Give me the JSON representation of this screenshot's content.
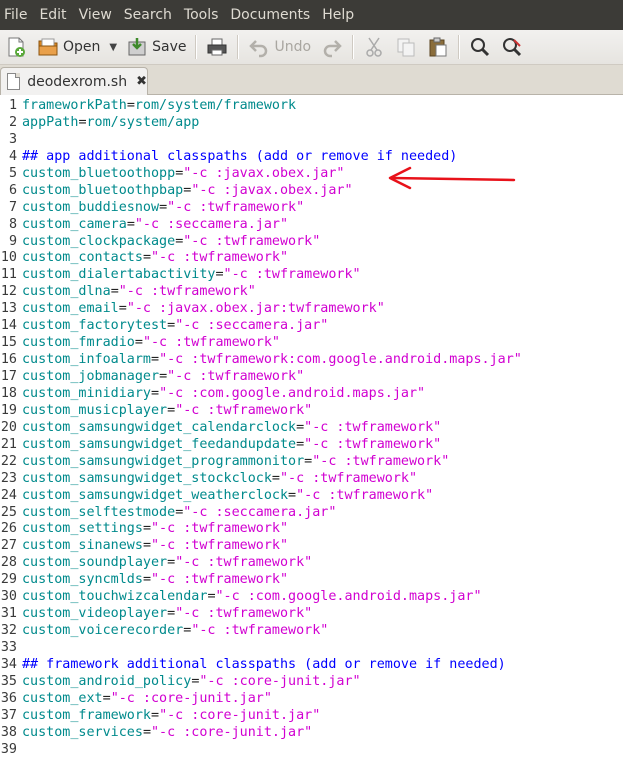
{
  "menubar": {
    "items": [
      "File",
      "Edit",
      "View",
      "Search",
      "Tools",
      "Documents",
      "Help"
    ]
  },
  "toolbar": {
    "new_icon": "new-document-icon",
    "open_label": "Open",
    "open_icon": "open-folder-icon",
    "save_label": "Save",
    "save_icon": "save-icon",
    "print_icon": "print-icon",
    "undo_label": "Undo",
    "undo_icon": "undo-icon",
    "redo_icon": "redo-icon",
    "cut_icon": "cut-icon",
    "copy_icon": "copy-icon",
    "paste_icon": "paste-icon",
    "find_icon": "find-icon",
    "replace_icon": "find-replace-icon"
  },
  "tab": {
    "filename": "deodexrom.sh",
    "close_glyph": "✖"
  },
  "colors": {
    "variable": "#008a8c",
    "string": "#d100d1",
    "comment": "#0000ff",
    "annotation_arrow": "#e8121a"
  },
  "code": {
    "lines": [
      {
        "n": "1",
        "var": "frameworkPath",
        "op": "=",
        "str": "",
        "plain": "rom/system/framework"
      },
      {
        "n": "2",
        "var": "appPath",
        "op": "=",
        "str": "",
        "plain": "rom/system/app"
      },
      {
        "n": "3",
        "var": "",
        "op": "",
        "str": "",
        "plain": ""
      },
      {
        "n": "4",
        "comment": "## app additional classpaths (add or remove if needed)"
      },
      {
        "n": "5",
        "var": "custom_bluetoothopp",
        "op": "=",
        "str": "\"-c :javax.obex.jar\""
      },
      {
        "n": "6",
        "var": "custom_bluetoothpbap",
        "op": "=",
        "str": "\"-c :javax.obex.jar\""
      },
      {
        "n": "7",
        "var": "custom_buddiesnow",
        "op": "=",
        "str": "\"-c :twframework\""
      },
      {
        "n": "8",
        "var": "custom_camera",
        "op": "=",
        "str": "\"-c :seccamera.jar\""
      },
      {
        "n": "9",
        "var": "custom_clockpackage",
        "op": "=",
        "str": "\"-c :twframework\""
      },
      {
        "n": "10",
        "var": "custom_contacts",
        "op": "=",
        "str": "\"-c :twframework\""
      },
      {
        "n": "11",
        "var": "custom_dialertabactivity",
        "op": "=",
        "str": "\"-c :twframework\""
      },
      {
        "n": "12",
        "var": "custom_dlna",
        "op": "=",
        "str": "\"-c :twframework\""
      },
      {
        "n": "13",
        "var": "custom_email",
        "op": "=",
        "str": "\"-c :javax.obex.jar:twframework\""
      },
      {
        "n": "14",
        "var": "custom_factorytest",
        "op": "=",
        "str": "\"-c :seccamera.jar\""
      },
      {
        "n": "15",
        "var": "custom_fmradio",
        "op": "=",
        "str": "\"-c :twframework\""
      },
      {
        "n": "16",
        "var": "custom_infoalarm",
        "op": "=",
        "str": "\"-c :twframework:com.google.android.maps.jar\""
      },
      {
        "n": "17",
        "var": "custom_jobmanager",
        "op": "=",
        "str": "\"-c :twframework\""
      },
      {
        "n": "18",
        "var": "custom_minidiary",
        "op": "=",
        "str": "\"-c :com.google.android.maps.jar\""
      },
      {
        "n": "19",
        "var": "custom_musicplayer",
        "op": "=",
        "str": "\"-c :twframework\""
      },
      {
        "n": "20",
        "var": "custom_samsungwidget_calendarclock",
        "op": "=",
        "str": "\"-c :twframework\""
      },
      {
        "n": "21",
        "var": "custom_samsungwidget_feedandupdate",
        "op": "=",
        "str": "\"-c :twframework\""
      },
      {
        "n": "22",
        "var": "custom_samsungwidget_programmonitor",
        "op": "=",
        "str": "\"-c :twframework\""
      },
      {
        "n": "23",
        "var": "custom_samsungwidget_stockclock",
        "op": "=",
        "str": "\"-c :twframework\""
      },
      {
        "n": "24",
        "var": "custom_samsungwidget_weatherclock",
        "op": "=",
        "str": "\"-c :twframework\""
      },
      {
        "n": "25",
        "var": "custom_selftestmode",
        "op": "=",
        "str": "\"-c :seccamera.jar\""
      },
      {
        "n": "26",
        "var": "custom_settings",
        "op": "=",
        "str": "\"-c :twframework\""
      },
      {
        "n": "27",
        "var": "custom_sinanews",
        "op": "=",
        "str": "\"-c :twframework\""
      },
      {
        "n": "28",
        "var": "custom_soundplayer",
        "op": "=",
        "str": "\"-c :twframework\""
      },
      {
        "n": "29",
        "var": "custom_syncmlds",
        "op": "=",
        "str": "\"-c :twframework\""
      },
      {
        "n": "30",
        "var": "custom_touchwizcalendar",
        "op": "=",
        "str": "\"-c :com.google.android.maps.jar\""
      },
      {
        "n": "31",
        "var": "custom_videoplayer",
        "op": "=",
        "str": "\"-c :twframework\""
      },
      {
        "n": "32",
        "var": "custom_voicerecorder",
        "op": "=",
        "str": "\"-c :twframework\""
      },
      {
        "n": "33",
        "var": "",
        "op": "",
        "str": ""
      },
      {
        "n": "34",
        "comment": "## framework additional classpaths (add or remove if needed)"
      },
      {
        "n": "35",
        "var": "custom_android_policy",
        "op": "=",
        "str": "\"-c :core-junit.jar\""
      },
      {
        "n": "36",
        "var": "custom_ext",
        "op": "=",
        "str": "\"-c :core-junit.jar\""
      },
      {
        "n": "37",
        "var": "custom_framework",
        "op": "=",
        "str": "\"-c :core-junit.jar\""
      },
      {
        "n": "38",
        "var": "custom_services",
        "op": "=",
        "str": "\"-c :core-junit.jar\""
      },
      {
        "n": "39",
        "var": "",
        "op": "",
        "str": ""
      }
    ]
  }
}
